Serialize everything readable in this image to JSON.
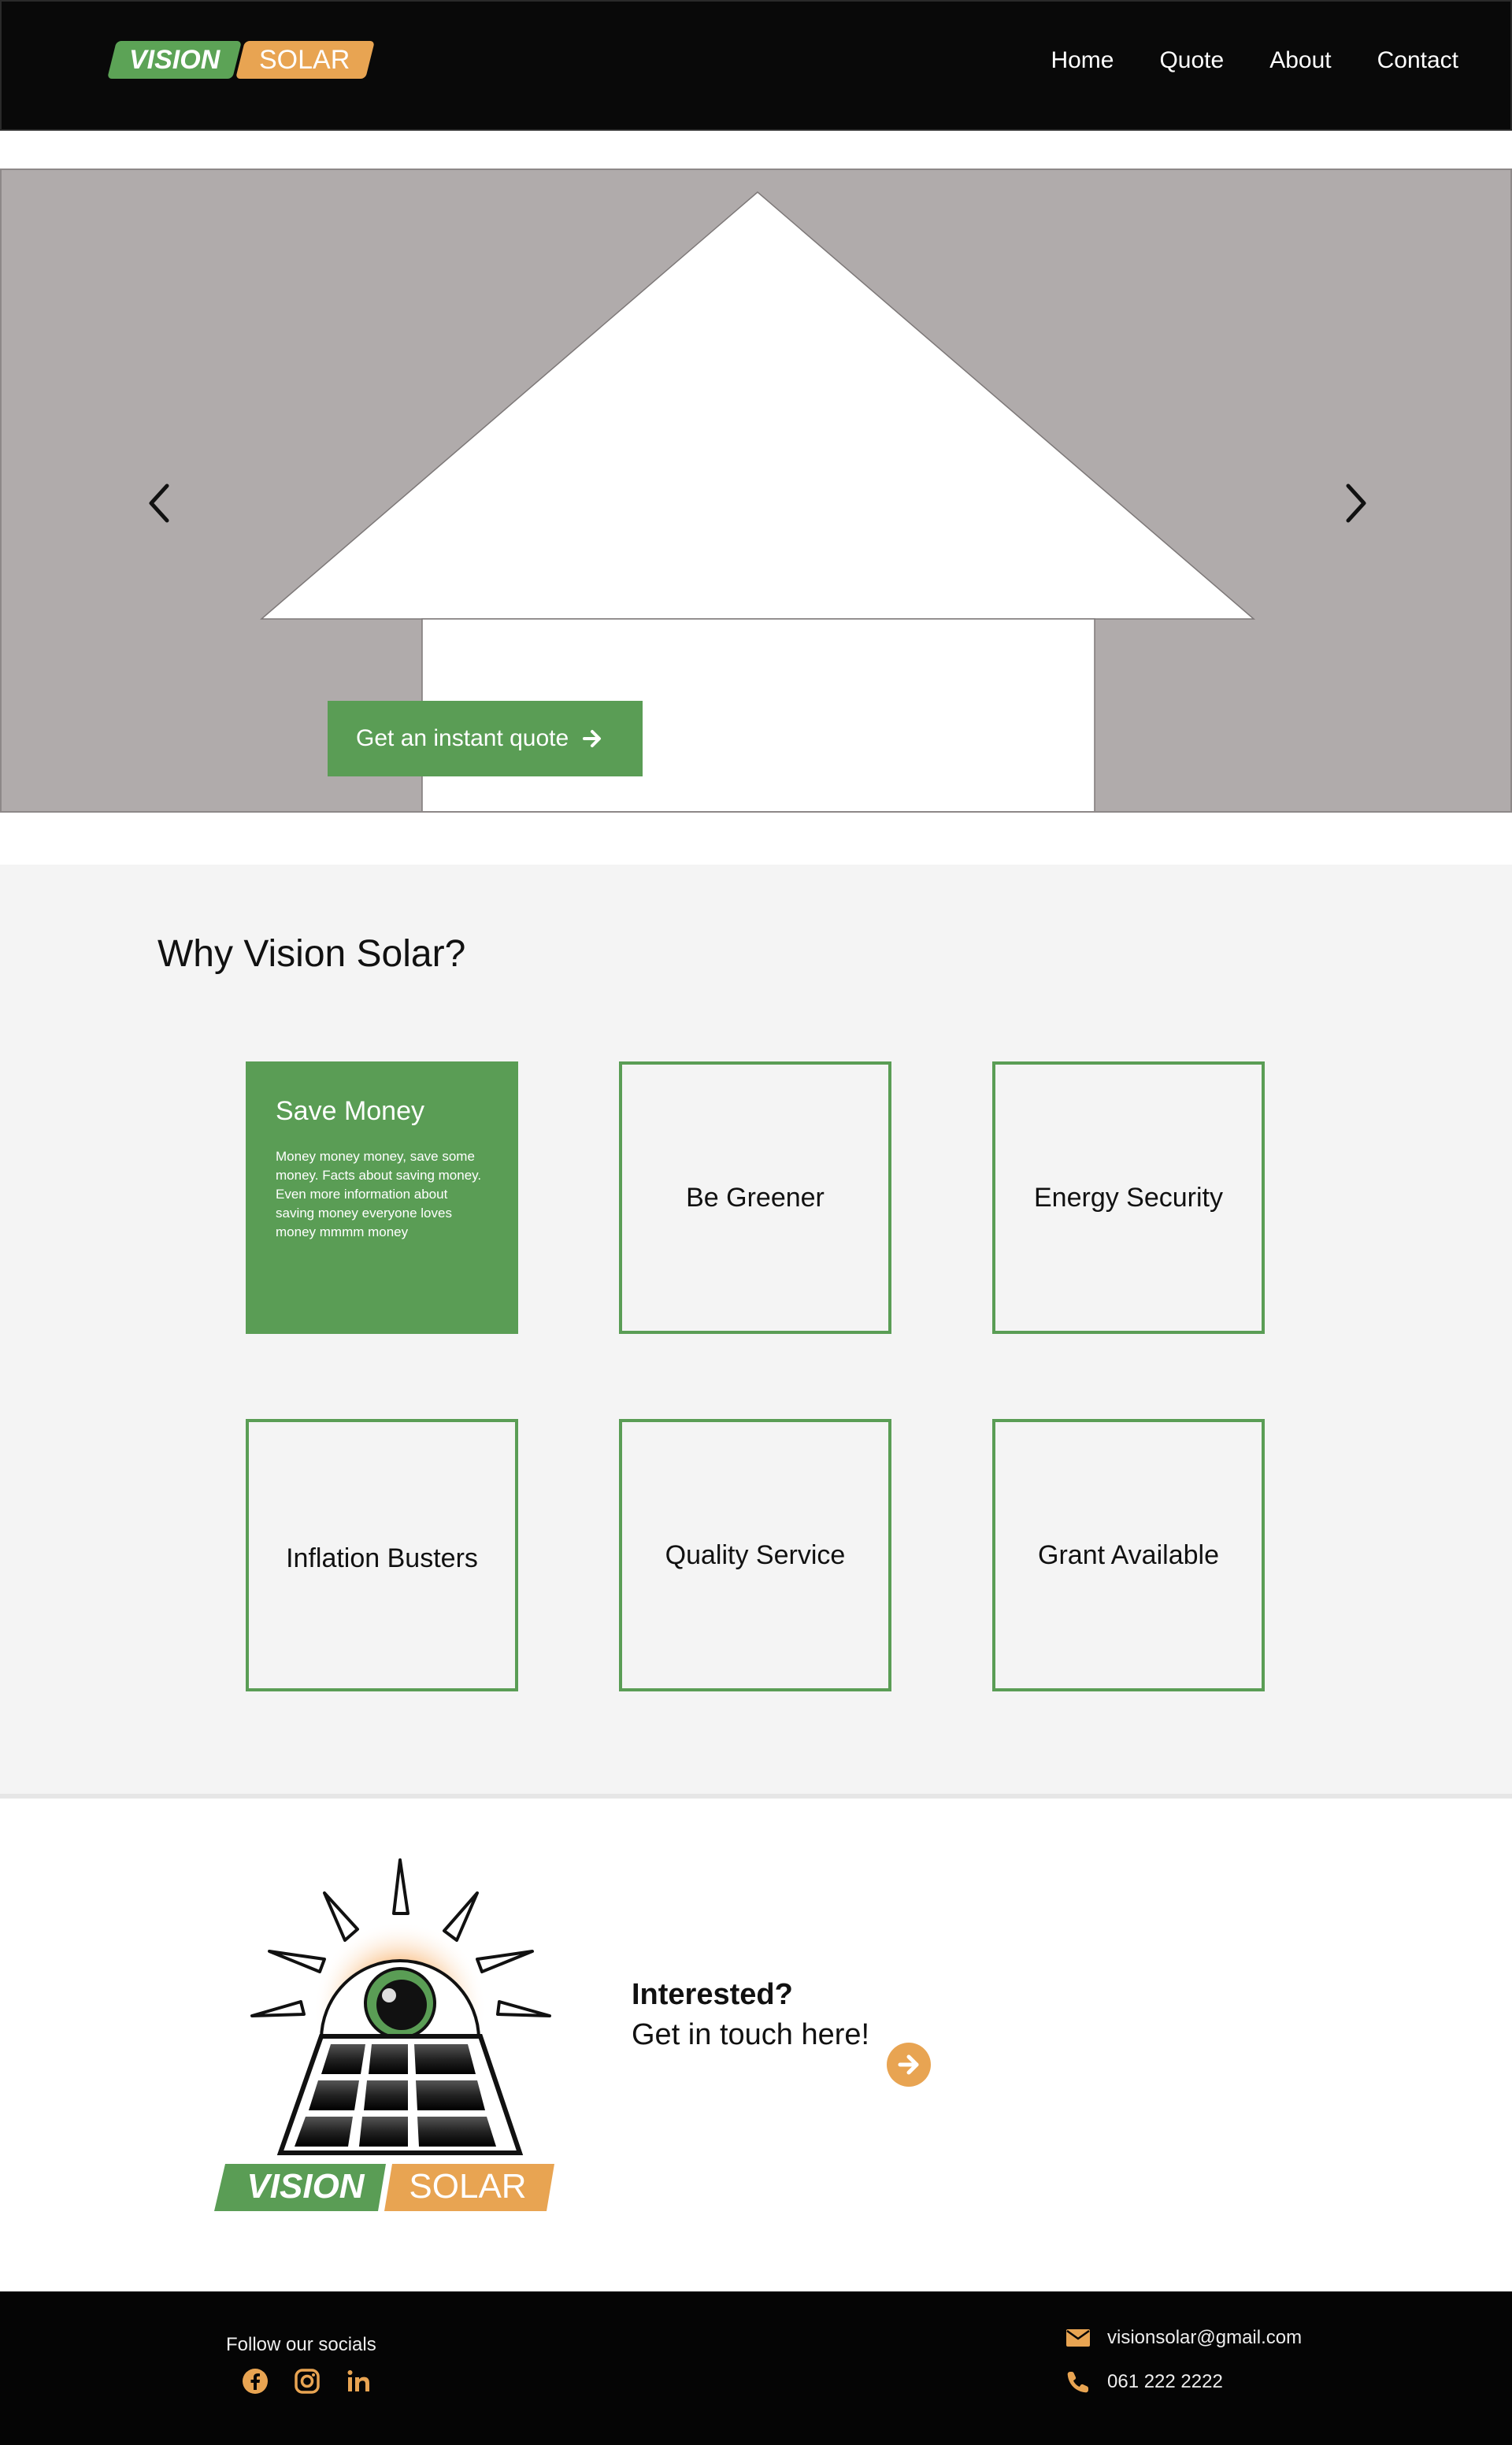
{
  "header": {
    "logo_left": "VISION",
    "logo_right": "SOLAR",
    "nav": [
      "Home",
      "Quote",
      "About",
      "Contact"
    ]
  },
  "hero": {
    "cta_label": "Get an instant quote"
  },
  "why": {
    "title": "Why Vision Solar?",
    "cards": [
      {
        "title": "Save Money",
        "description": "Money money money, save some money. Facts about saving money.\nEven more information about saving money everyone loves money mmmm money"
      },
      {
        "title": "Be Greener"
      },
      {
        "title": "Energy Security"
      },
      {
        "title": "Inflation Busters"
      },
      {
        "title": "Quality Service"
      },
      {
        "title": "Grant Available"
      }
    ]
  },
  "interest": {
    "title": "Interested?",
    "subtitle": "Get in touch here!"
  },
  "big_logo": {
    "left": "VISION",
    "right": "SOLAR"
  },
  "footer": {
    "follow": "Follow our socials",
    "email": "visionsolar@gmail.com",
    "phone": "061 222 2222"
  },
  "colors": {
    "green": "#5a9d55",
    "orange": "#e8a452",
    "dark": "#090909",
    "hero_bg": "#b0abab"
  },
  "icons": [
    "chevron-left-icon",
    "chevron-right-icon",
    "arrow-right-icon",
    "facebook-icon",
    "instagram-icon",
    "linkedin-icon",
    "mail-icon",
    "phone-icon"
  ]
}
